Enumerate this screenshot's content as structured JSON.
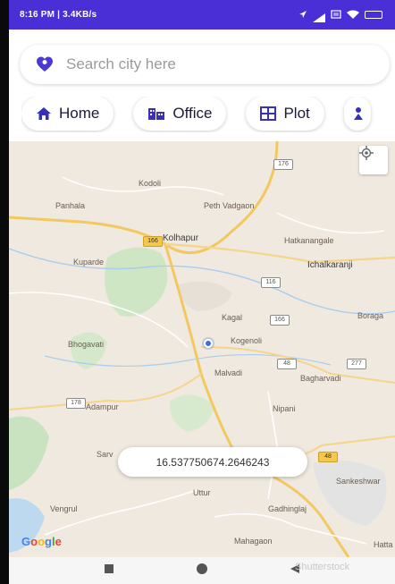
{
  "status_bar": {
    "time_network": "8:16 PM | 3.4KB/s"
  },
  "search": {
    "placeholder": "Search city here"
  },
  "chips": [
    {
      "label": "Home",
      "icon": "home-icon"
    },
    {
      "label": "Office",
      "icon": "office-building-icon"
    },
    {
      "label": "Plot",
      "icon": "plot-grid-icon"
    }
  ],
  "map": {
    "labels": {
      "kodoli": "Kodoli",
      "peth_vadgaon": "Peth Vadgaon",
      "panhala": "Panhala",
      "kolhapur": "Kolhapur",
      "hatkanangale": "Hatkanangale",
      "kuparde": "Kuparde",
      "ichalkaranji": "Ichalkaranji",
      "kagal": "Kagal",
      "kogenoli": "Kogenoli",
      "boraga": "Boraga",
      "bhogavati": "Bhogavati",
      "malvadi": "Malvadi",
      "bagharvadi": "Bagharvadi",
      "adampur": "Adampur",
      "nipani": "Nipani",
      "sarvade": "Sarv",
      "sankeshwar": "Sankeshwar",
      "uttur": "Uttur",
      "gadhinglaj": "Gadhinglaj",
      "vengrul": "Vengrul",
      "mahagaon": "Mahagaon",
      "hattargi": "Hatta"
    },
    "highway_shields": {
      "s1": "176",
      "s2": "166",
      "s3": "116",
      "s4": "166",
      "s5": "48",
      "s6": "277",
      "s7": "178",
      "s8": "48"
    },
    "coordinate_readout": "16.537750674.2646243",
    "google_logo": "Google"
  },
  "watermark": "Shutterstock"
}
